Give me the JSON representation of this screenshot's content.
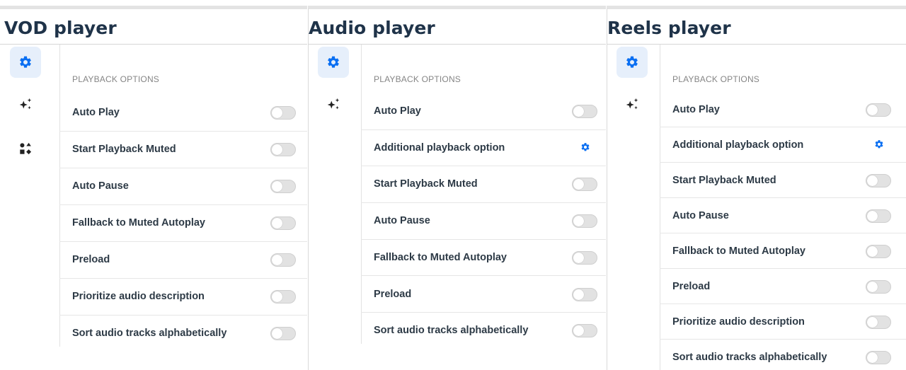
{
  "colors": {
    "accent": "#0a6ff2",
    "title": "#1f3349",
    "toggle_off": "#e2e2e2"
  },
  "panels": [
    {
      "title": "VOD player",
      "rail": [
        "settings-icon",
        "sparkles-icon",
        "shapes-icon"
      ],
      "section_label": "PLAYBACK OPTIONS",
      "options": [
        {
          "label": "Auto Play",
          "control": "toggle",
          "on": false
        },
        {
          "label": "Start Playback Muted",
          "control": "toggle",
          "on": false
        },
        {
          "label": "Auto Pause",
          "control": "toggle",
          "on": false
        },
        {
          "label": "Fallback to Muted Autoplay",
          "control": "toggle",
          "on": false
        },
        {
          "label": "Preload",
          "control": "toggle",
          "on": false
        },
        {
          "label": "Prioritize audio description",
          "control": "toggle",
          "on": false
        },
        {
          "label": "Sort audio tracks alphabetically",
          "control": "toggle",
          "on": false
        }
      ]
    },
    {
      "title": "Audio player",
      "rail": [
        "settings-icon",
        "sparkles-icon"
      ],
      "section_label": "PLAYBACK OPTIONS",
      "options": [
        {
          "label": "Auto Play",
          "control": "toggle",
          "on": false
        },
        {
          "label": "Additional playback option",
          "control": "settings",
          "on": false
        },
        {
          "label": "Start Playback Muted",
          "control": "toggle",
          "on": false
        },
        {
          "label": "Auto Pause",
          "control": "toggle",
          "on": false
        },
        {
          "label": "Fallback to Muted Autoplay",
          "control": "toggle",
          "on": false
        },
        {
          "label": "Preload",
          "control": "toggle",
          "on": false
        },
        {
          "label": "Sort audio tracks alphabetically",
          "control": "toggle",
          "on": false
        }
      ]
    },
    {
      "title": "Reels player",
      "rail": [
        "settings-icon",
        "sparkles-icon"
      ],
      "section_label": "PLAYBACK OPTIONS",
      "options": [
        {
          "label": "Auto Play",
          "control": "toggle",
          "on": false
        },
        {
          "label": "Additional playback option",
          "control": "settings",
          "on": false
        },
        {
          "label": "Start Playback Muted",
          "control": "toggle",
          "on": false
        },
        {
          "label": "Auto Pause",
          "control": "toggle",
          "on": false
        },
        {
          "label": "Fallback to Muted Autoplay",
          "control": "toggle",
          "on": false
        },
        {
          "label": "Preload",
          "control": "toggle",
          "on": false
        },
        {
          "label": "Prioritize audio description",
          "control": "toggle",
          "on": false
        },
        {
          "label": "Sort audio tracks alphabetically",
          "control": "toggle",
          "on": false
        }
      ]
    }
  ]
}
